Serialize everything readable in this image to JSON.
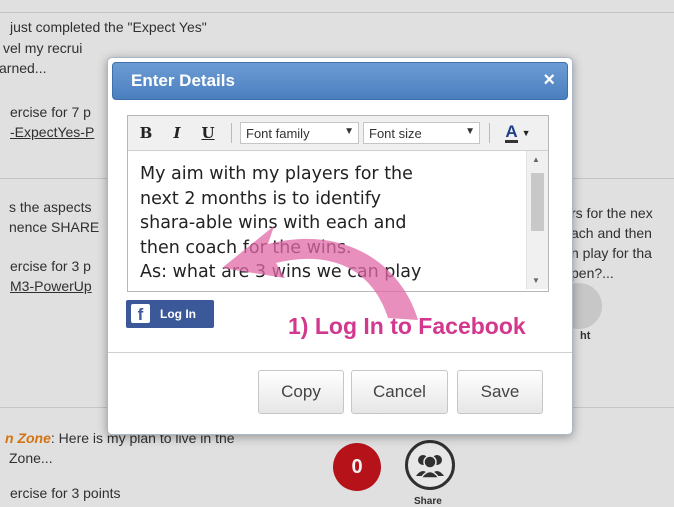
{
  "background": {
    "lines": [
      "just completed the \"Expect Yes\"",
      "vel my recrui",
      "arned...",
      "ercise for 7 p",
      "-ExpectYes-P",
      "s the aspects",
      "nence SHARE",
      "ercise for 3 p",
      "M3-PowerUp",
      "Zone...",
      "ercise for 3 points"
    ],
    "right_lines": [
      "rs for the nex",
      "ach and then",
      "n play for tha",
      "pen?..."
    ],
    "zone_label": "n Zone",
    "zone_tail": ": Here is my plan to live in the",
    "share_suffix": "ht",
    "badge_count": "0",
    "share_label": "Share"
  },
  "modal": {
    "title": "Enter Details",
    "close_glyph": "×",
    "toolbar": {
      "bold": "B",
      "italic": "I",
      "underline": "U",
      "font_family": "Font family",
      "font_size": "Font size",
      "font_color": "A"
    },
    "content_lines": [
      "My aim with my players for the",
      "next 2 months is to identify",
      "shara-able wins with each and",
      "then coach for the wins.",
      "As: what are 3 wins we can play"
    ],
    "facebook_button": "Log In",
    "facebook_glyph": "f",
    "buttons": {
      "copy": "Copy",
      "cancel": "Cancel",
      "save": "Save"
    }
  },
  "annotation": {
    "text": "1) Log In to Facebook",
    "color": "#d3388f"
  }
}
